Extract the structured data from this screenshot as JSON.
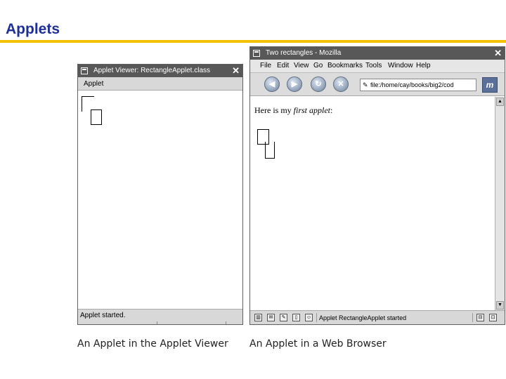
{
  "slide": {
    "title": "Applets"
  },
  "applet_viewer": {
    "window_title": "Applet Viewer: RectangleApplet.class",
    "close_glyph": "✕",
    "menu_label": "Applet",
    "status_text": "Applet started."
  },
  "browser": {
    "window_title": "Two rectangles - Mozilla",
    "close_glyph": "✕",
    "menus": [
      "File",
      "Edit",
      "View",
      "Go",
      "Bookmarks",
      "Tools",
      "Window",
      "Help"
    ],
    "url": "file:/home/cay/books/big2/cod",
    "page_text_plain": "Here is my ",
    "page_text_italic": "first applet",
    "page_text_end": ":",
    "status_text": "Applet RectangleApplet started",
    "throbber_glyph": "m"
  },
  "captions": {
    "left": "An Applet in the Applet Viewer",
    "right": "An Applet in a Web Browser"
  }
}
